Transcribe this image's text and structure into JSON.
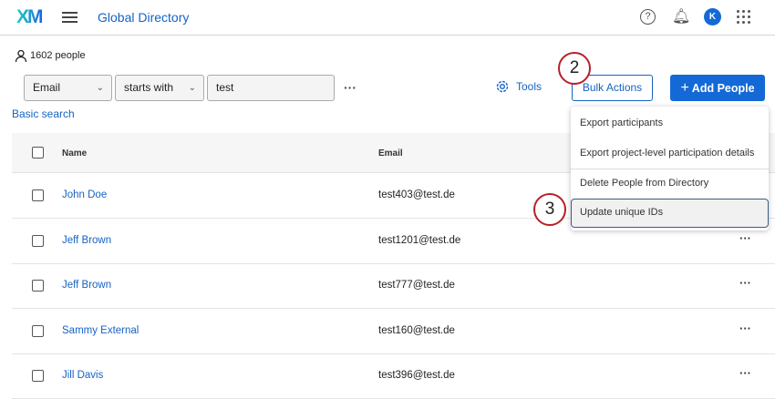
{
  "header": {
    "logo": "XM",
    "title": "Global Directory",
    "avatar_initial": "K",
    "icons": [
      "help-icon",
      "bell-icon",
      "apps-grid-icon"
    ]
  },
  "toolbar": {
    "people_count": "1602 people",
    "field_select": "Email",
    "operator_select": "starts with",
    "search_value": "test",
    "basic_search": "Basic search",
    "tools": "Tools",
    "bulk_actions": "Bulk Actions",
    "add_people": "Add People"
  },
  "table": {
    "columns": [
      "Name",
      "Email"
    ],
    "rows": [
      {
        "name": "John Doe",
        "email": "test403@test.de"
      },
      {
        "name": "Jeff Brown",
        "email": "test1201@test.de"
      },
      {
        "name": "Jeff Brown",
        "email": "test777@test.de"
      },
      {
        "name": "Sammy External",
        "email": "test160@test.de"
      },
      {
        "name": "Jill Davis",
        "email": "test396@test.de"
      }
    ]
  },
  "menu": {
    "items": [
      "Export participants",
      "Export project-level participation details",
      "Delete People from Directory",
      "Update unique IDs"
    ]
  },
  "callouts": [
    "2",
    "3"
  ]
}
